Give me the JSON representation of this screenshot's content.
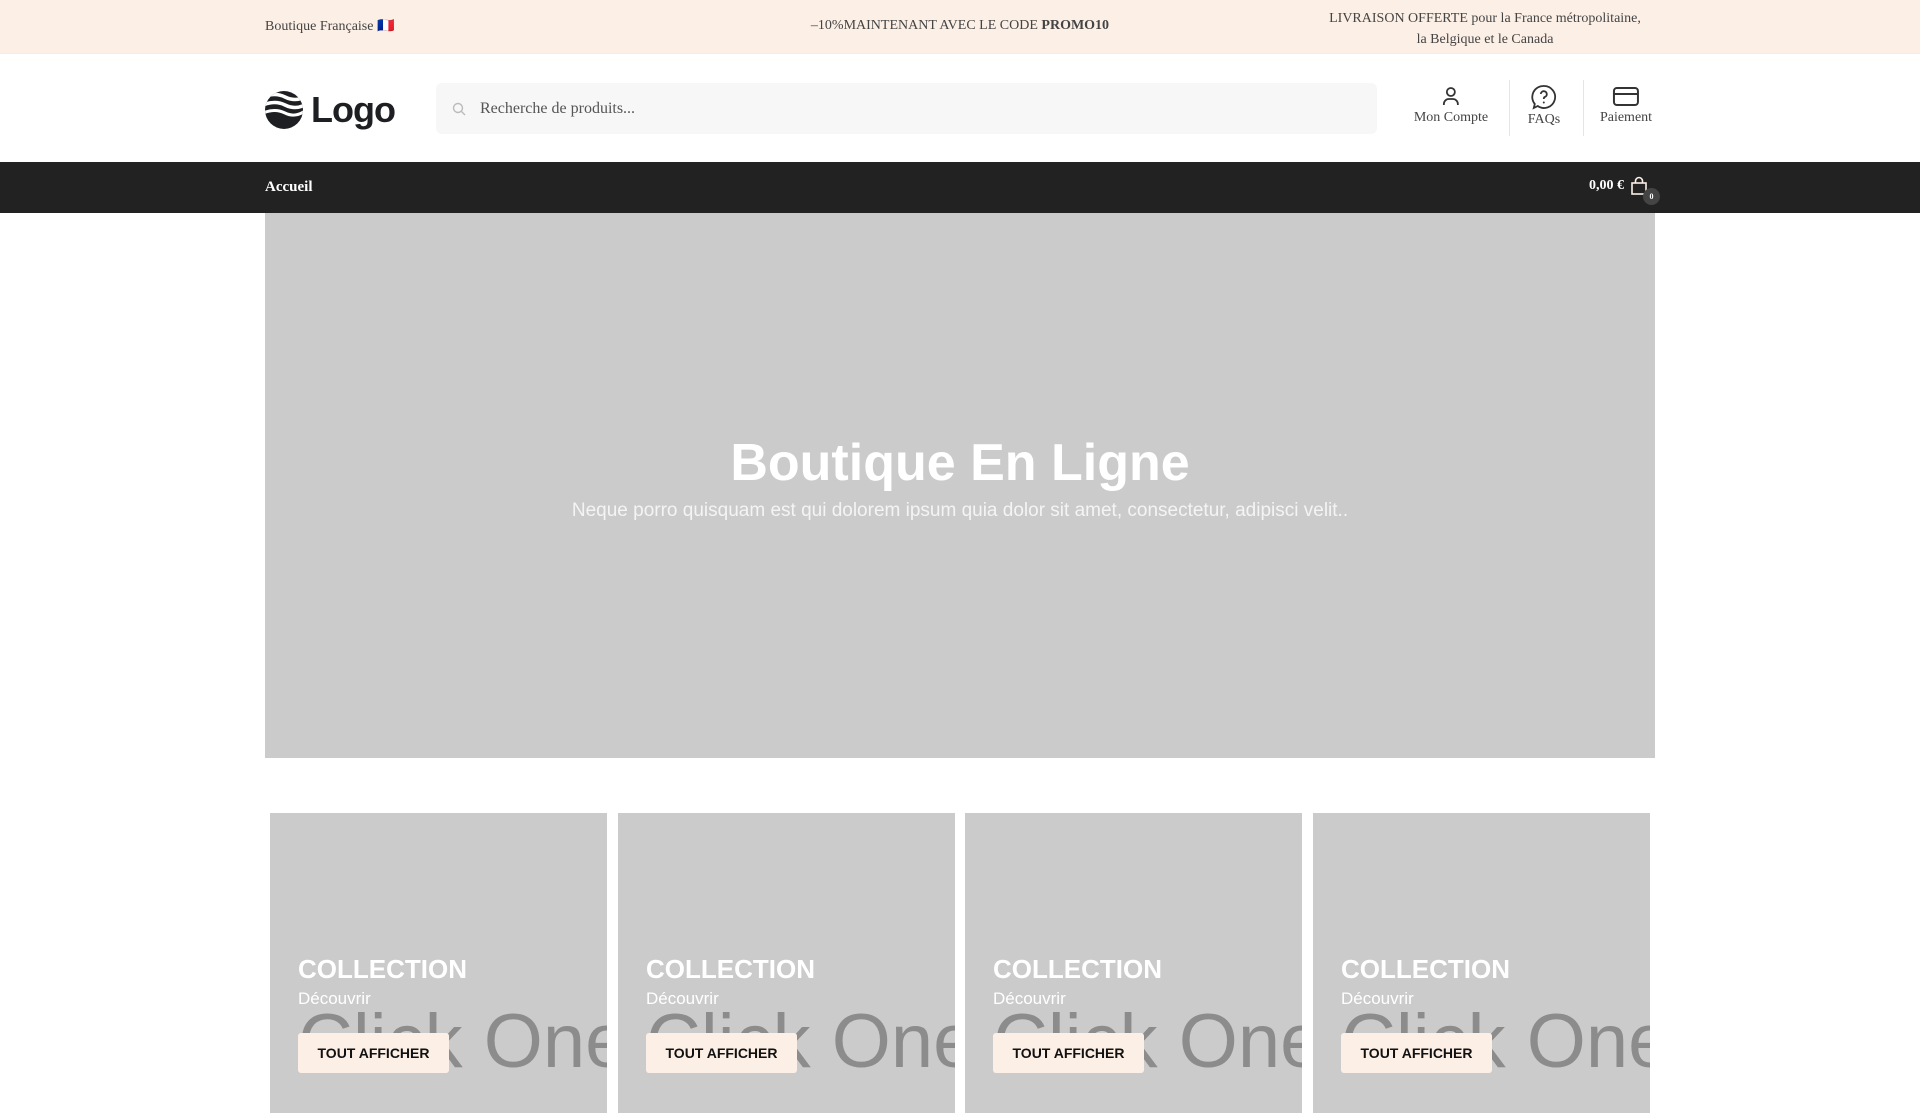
{
  "topbar": {
    "left": "Boutique Française 🇫🇷",
    "promo_prefix": "–10%MAINTENANT AVEC LE CODE ",
    "promo_code": "PROMO10",
    "shipping_line1": "LIVRAISON OFFERTE pour la France métropolitaine,",
    "shipping_line2": "la Belgique et le Canada"
  },
  "header": {
    "logo": "Logo",
    "search_placeholder": "Recherche de produits...",
    "account": "Mon Compte",
    "faqs": "FAQs",
    "payment": "Paiement"
  },
  "nav": {
    "home": "Accueil",
    "cart_total": "0,00 €",
    "cart_count": "0"
  },
  "hero": {
    "title": "Boutique En Ligne",
    "subtitle": "Neque porro quisquam est qui dolorem ipsum quia dolor sit amet, consectetur, adipisci velit.."
  },
  "cards": [
    {
      "title": "COLLECTION",
      "subtitle": "Découvrir",
      "button": "TOUT AFFICHER",
      "watermark": "Click One"
    },
    {
      "title": "COLLECTION",
      "subtitle": "Découvrir",
      "button": "TOUT AFFICHER",
      "watermark": "Click One"
    },
    {
      "title": "COLLECTION",
      "subtitle": "Découvrir",
      "button": "TOUT AFFICHER",
      "watermark": "Click One"
    },
    {
      "title": "COLLECTION",
      "subtitle": "Découvrir",
      "button": "TOUT AFFICHER",
      "watermark": "Click One"
    }
  ]
}
